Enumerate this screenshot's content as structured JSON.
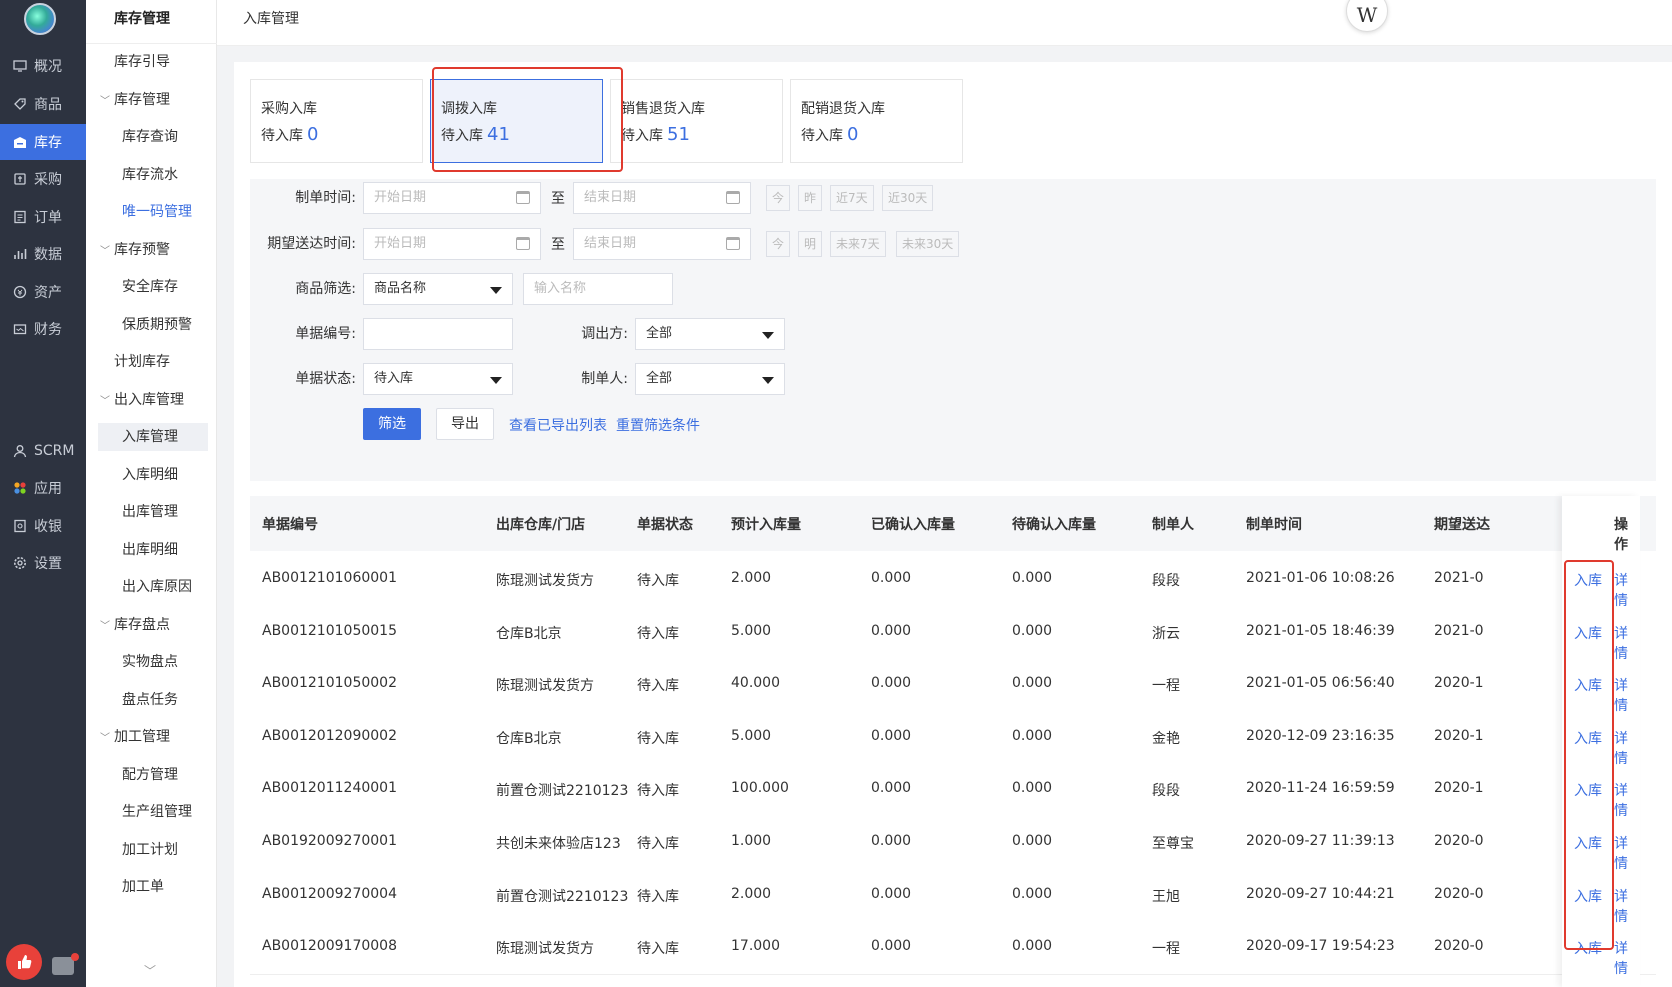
{
  "top_nav": [
    {
      "label": "概况",
      "icon": "monitor-icon"
    },
    {
      "label": "商品",
      "icon": "tag-icon"
    },
    {
      "label": "库存",
      "icon": "warehouse-icon"
    },
    {
      "label": "采购",
      "icon": "purchase-icon"
    },
    {
      "label": "订单",
      "icon": "order-icon"
    },
    {
      "label": "数据",
      "icon": "bar-chart-icon"
    },
    {
      "label": "资产",
      "icon": "coin-icon"
    },
    {
      "label": "财务",
      "icon": "wallet-icon"
    }
  ],
  "bottom_nav": [
    {
      "label": "SCRM",
      "icon": "user-icon"
    },
    {
      "label": "应用",
      "icon": "apps-icon"
    },
    {
      "label": "收银",
      "icon": "cashier-icon"
    },
    {
      "label": "设置",
      "icon": "gear-icon"
    }
  ],
  "active_nav_index": 2,
  "sidebar": {
    "title": "库存管理",
    "items": [
      {
        "label": "库存引导",
        "level": 1,
        "chev": ""
      },
      {
        "label": "库存管理",
        "level": 1,
        "chev": "v"
      },
      {
        "label": "库存查询",
        "level": 2
      },
      {
        "label": "库存流水",
        "level": 2
      },
      {
        "label": "唯一码管理",
        "level": 2,
        "blue": true
      },
      {
        "label": "库存预警",
        "level": 1,
        "chev": "v"
      },
      {
        "label": "安全库存",
        "level": 2
      },
      {
        "label": "保质期预警",
        "level": 2
      },
      {
        "label": "计划库存",
        "level": 1,
        "chev": ""
      },
      {
        "label": "出入库管理",
        "level": 1,
        "chev": "v"
      },
      {
        "label": "入库管理",
        "level": 2,
        "selected": true
      },
      {
        "label": "入库明细",
        "level": 2
      },
      {
        "label": "出库管理",
        "level": 2
      },
      {
        "label": "出库明细",
        "level": 2
      },
      {
        "label": "出入库原因",
        "level": 2
      },
      {
        "label": "库存盘点",
        "level": 1,
        "chev": "v"
      },
      {
        "label": "实物盘点",
        "level": 2
      },
      {
        "label": "盘点任务",
        "level": 2
      },
      {
        "label": "加工管理",
        "level": 1,
        "chev": "v"
      },
      {
        "label": "配方管理",
        "level": 2
      },
      {
        "label": "生产组管理",
        "level": 2
      },
      {
        "label": "加工计划",
        "level": 2
      },
      {
        "label": "加工单",
        "level": 2
      }
    ]
  },
  "header": {
    "title": "入库管理",
    "avatar_letter": "W"
  },
  "cards": [
    {
      "name": "采购入库",
      "sub": "待入库",
      "count": "0"
    },
    {
      "name": "调拨入库",
      "sub": "待入库",
      "count": "41",
      "active": true
    },
    {
      "name": "销售退货入库",
      "sub": "待入库",
      "count": "51"
    },
    {
      "name": "配销退货入库",
      "sub": "待入库",
      "count": "0"
    }
  ],
  "filter": {
    "create_time_label": "制单时间:",
    "expect_time_label": "期望送达时间:",
    "start_placeholder": "开始日期",
    "end_placeholder": "结束日期",
    "to_label": "至",
    "quick1": [
      "今",
      "昨",
      "近7天",
      "近30天"
    ],
    "quick2": [
      "今",
      "明",
      "未来7天",
      "未来30天"
    ],
    "goods_label": "商品筛选:",
    "goods_type": "商品名称",
    "goods_placeholder": "输入名称",
    "doc_no_label": "单据编号:",
    "doc_no_value": "",
    "out_party_label": "调出方:",
    "out_party_value": "全部",
    "status_label": "单据状态:",
    "status_value": "待入库",
    "creator_label": "制单人:",
    "creator_value": "全部",
    "filter_button": "筛选",
    "export_button": "导出",
    "view_exports_link": "查看已导出列表",
    "reset_link": "重置筛选条件"
  },
  "table": {
    "columns": [
      "单据编号",
      "出库仓库/门店",
      "单据状态",
      "预计入库量",
      "已确认入库量",
      "待确认入库量",
      "制单人",
      "制单时间",
      "期望送达",
      "操作"
    ],
    "rows": [
      {
        "no": "AB0012101060001",
        "from": "陈琨测试发货方",
        "status": "待入库",
        "expected": "2.000",
        "confirmed": "0.000",
        "pending": "0.000",
        "creator": "段段",
        "time": "2021-01-06 10:08:26",
        "eta": "2021-0"
      },
      {
        "no": "AB0012101050015",
        "from": "仓库B北京",
        "status": "待入库",
        "expected": "5.000",
        "confirmed": "0.000",
        "pending": "0.000",
        "creator": "浙云",
        "time": "2021-01-05 18:46:39",
        "eta": "2021-0"
      },
      {
        "no": "AB0012101050002",
        "from": "陈琨测试发货方",
        "status": "待入库",
        "expected": "40.000",
        "confirmed": "0.000",
        "pending": "0.000",
        "creator": "一程",
        "time": "2021-01-05 06:56:40",
        "eta": "2020-1"
      },
      {
        "no": "AB0012012090002",
        "from": "仓库B北京",
        "status": "待入库",
        "expected": "5.000",
        "confirmed": "0.000",
        "pending": "0.000",
        "creator": "金艳",
        "time": "2020-12-09 23:16:35",
        "eta": "2020-1"
      },
      {
        "no": "AB0012011240001",
        "from": "前置仓测试2210123",
        "status": "待入库",
        "expected": "100.000",
        "confirmed": "0.000",
        "pending": "0.000",
        "creator": "段段",
        "time": "2020-11-24 16:59:59",
        "eta": "2020-1"
      },
      {
        "no": "AB0192009270001",
        "from": "共创未来体验店123",
        "status": "待入库",
        "expected": "1.000",
        "confirmed": "0.000",
        "pending": "0.000",
        "creator": "至尊宝",
        "time": "2020-09-27 11:39:13",
        "eta": "2020-0"
      },
      {
        "no": "AB0012009270004",
        "from": "前置仓测试2210123",
        "status": "待入库",
        "expected": "2.000",
        "confirmed": "0.000",
        "pending": "0.000",
        "creator": "王旭",
        "time": "2020-09-27 10:44:21",
        "eta": "2020-0"
      },
      {
        "no": "AB0012009170008",
        "from": "陈琨测试发货方",
        "status": "待入库",
        "expected": "17.000",
        "confirmed": "0.000",
        "pending": "0.000",
        "creator": "一程",
        "time": "2020-09-17 19:54:23",
        "eta": "2020-0"
      }
    ],
    "op_inbound": "入库",
    "op_detail": "详情"
  },
  "colors": {
    "accent": "#3c6fe0",
    "nav_bg": "#2d3340",
    "highlight": "#e03a2e"
  }
}
